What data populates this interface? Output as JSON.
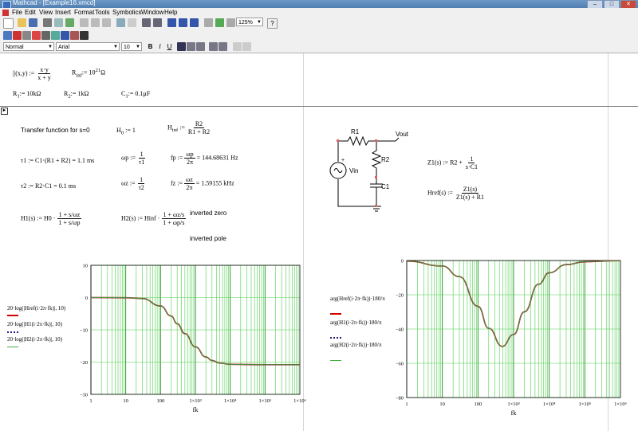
{
  "window": {
    "title": "Mathcad - [Example16.xmcd]",
    "controls": [
      "–",
      "□",
      "✕"
    ]
  },
  "menu": [
    "File",
    "Edit",
    "View",
    "Insert",
    "Format",
    "Tools",
    "Symbolics",
    "Window",
    "Help"
  ],
  "toolbar": {
    "zoom": "125%",
    "style": "Normal",
    "font": "Arial",
    "font_size": "10",
    "bold": "B",
    "italic": "I",
    "underline": "U"
  },
  "defs": {
    "parallel_lhs": "||(x,y) :=",
    "parallel_num": "x·y",
    "parallel_den": "x + y",
    "rinf": "R",
    "rinf_sub": "inf",
    "rinf_val": ":= 10",
    "rinf_exp": "21",
    "rinf_unit": "Ω",
    "r1": "R",
    "r1_sub": "1",
    "r1_val": ":= 10kΩ",
    "r2": "R",
    "r2_sub": "2",
    "r2_val": ":= 1kΩ",
    "c1": "C",
    "c1_sub": "1",
    "c1_val": ":= 0.1μF"
  },
  "region": {
    "tf_label": "Transfer function for s=0",
    "h0": "H",
    "h0_sub": "0",
    "h0_val": ":= 1",
    "hinf": "H",
    "hinf_sub": "inf",
    "hinf_num": "R2",
    "hinf_den": "R1 + R2",
    "tau1": "τ1 := C1·(R1 + R2) = 1.1 ms",
    "omegap": "ωp :=",
    "omegap_num": "1",
    "omegap_den": "τ1",
    "fp": "fp :=",
    "fp_num": "ωp",
    "fp_den": "2π",
    "fp_res": "= 144.68631 Hz",
    "tau2": "τ2 := R2·C1 = 0.1 ms",
    "omegaz": "ωz :=",
    "omegaz_num": "1",
    "omegaz_den": "τ2",
    "fz": "fz :=",
    "fz_num": "ωz",
    "fz_den": "2π",
    "fz_res": "= 1.59155 kHz",
    "h1": "H1(s) := H0 ·",
    "h1_num": "1 + s/ωz",
    "h1_den": "1 + s/ωp",
    "h2": "H2(s) := Hinf ·",
    "h2_num": "1 + ωz/s",
    "h2_den": "1 + ωp/s",
    "inv_zero": "inverted zero",
    "inv_pole": "inverted pole",
    "z1": "Z1(s) := R2 +",
    "z1_num": "1",
    "z1_den": "s·C1",
    "href": "Href(s) :=",
    "href_num": "Z1(s)",
    "href_den": "Z1(s) + R1"
  },
  "circuit": {
    "r1": "R1",
    "r2": "R2",
    "c1": "C1",
    "vin": "Vin",
    "vout": "Vout",
    "plus": "+"
  },
  "plot1": {
    "xlabel": "fk",
    "legend": [
      "20·log(|Href(i·2π·fk)|, 10)",
      "20·log(|H1(i·2π·fk)|, 10)",
      "20·log(|H2(i·2π·fk)|, 10)"
    ],
    "xticks": [
      "1",
      "10",
      "100",
      "1×10³",
      "1×10⁴",
      "1×10⁵",
      "1×10⁶"
    ],
    "yticks": [
      "10",
      "0",
      "−10",
      "−20",
      "−30"
    ],
    "colors": {
      "href": "#d00000",
      "h1": "#202080",
      "h2": "#40b040",
      "grid": "#4ecf4e"
    }
  },
  "plot2": {
    "xlabel": "fk",
    "legend": [
      "arg(Href(i·2π·fk))·180/π",
      "arg(H1(i·2π·fk))·180/π",
      "arg(H2(i·2π·fk))·180/π"
    ],
    "xticks": [
      "1",
      "10",
      "100",
      "1×10³",
      "1×10⁴",
      "1×10⁵",
      "1×10⁶"
    ],
    "yticks": [
      "0",
      "−20",
      "−40",
      "−60",
      "−80"
    ],
    "colors": {
      "href": "#d00000",
      "h1": "#202080",
      "h2": "#40b040",
      "grid": "#4ecf4e"
    }
  },
  "chart_data": [
    {
      "type": "line",
      "xscale": "log",
      "xlim": [
        1,
        1000000
      ],
      "ylim": [
        -30,
        10
      ],
      "grid": true,
      "legend_position": "left",
      "xlabel": "fk",
      "x": [
        1,
        10,
        30,
        100,
        200,
        300,
        500,
        1000,
        2000,
        3000,
        5000,
        10000,
        100000,
        1000000
      ],
      "series": [
        {
          "name": "20·log(|Href(i·2π·fk)|, 10)",
          "values": [
            0,
            -0.04,
            -0.3,
            -2.6,
            -5.7,
            -8.1,
            -11.2,
            -15.3,
            -18.4,
            -19.5,
            -20.3,
            -20.7,
            -20.8,
            -20.8
          ]
        },
        {
          "name": "20·log(|H1(i·2π·fk)|, 10)",
          "values": [
            0,
            -0.04,
            -0.3,
            -2.6,
            -5.7,
            -8.1,
            -11.2,
            -15.3,
            -18.4,
            -19.5,
            -20.3,
            -20.7,
            -20.8,
            -20.8
          ]
        },
        {
          "name": "20·log(|H2(i·2π·fk)|, 10)",
          "values": [
            0,
            -0.04,
            -0.3,
            -2.6,
            -5.7,
            -8.1,
            -11.2,
            -15.3,
            -18.4,
            -19.5,
            -20.3,
            -20.7,
            -20.8,
            -20.8
          ]
        }
      ]
    },
    {
      "type": "line",
      "xscale": "log",
      "xlim": [
        1,
        1000000
      ],
      "ylim": [
        -90,
        0
      ],
      "grid": true,
      "legend_position": "left",
      "xlabel": "fk",
      "x": [
        1,
        10,
        30,
        100,
        200,
        480,
        1000,
        2000,
        5000,
        10000,
        30000,
        100000,
        1000000
      ],
      "series": [
        {
          "name": "arg(Href(i·2π·fk))·180/π",
          "values": [
            -0.4,
            -3.6,
            -10.6,
            -30.1,
            -44.5,
            -56.4,
            -48.6,
            -33.7,
            -15.6,
            -8.1,
            -2.7,
            -0.8,
            -0.1
          ]
        },
        {
          "name": "arg(H1(i·2π·fk))·180/π",
          "values": [
            -0.4,
            -3.6,
            -10.6,
            -30.1,
            -44.5,
            -56.4,
            -48.6,
            -33.7,
            -15.6,
            -8.1,
            -2.7,
            -0.8,
            -0.1
          ]
        },
        {
          "name": "arg(H2(i·2π·fk))·180/π",
          "values": [
            -0.4,
            -3.6,
            -10.6,
            -30.1,
            -44.5,
            -56.4,
            -48.6,
            -33.7,
            -15.6,
            -8.1,
            -2.7,
            -0.8,
            -0.1
          ]
        }
      ]
    }
  ]
}
